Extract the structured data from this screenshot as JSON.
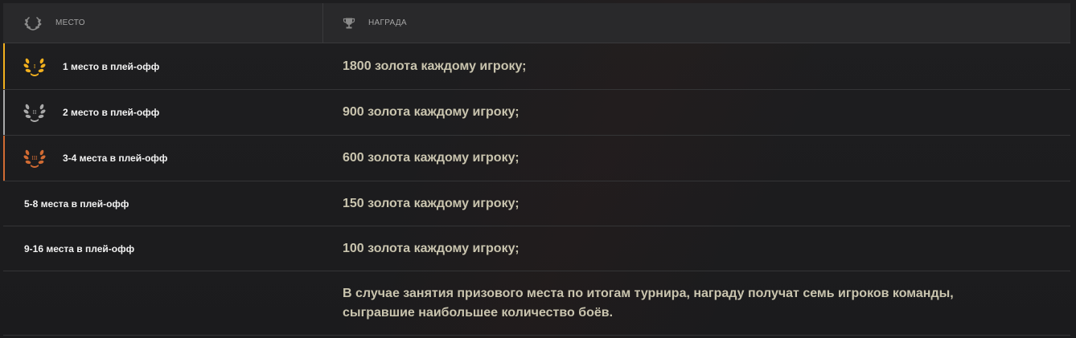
{
  "header": {
    "place_label": "МЕСТО",
    "reward_label": "НАГРАДА",
    "place_icon": "laurel-icon",
    "reward_icon": "trophy-icon"
  },
  "rows": [
    {
      "place": "1 место в плей-офф",
      "reward": "1800 золота каждому игроку;",
      "medal": "gold-laurel-icon",
      "numeral": "I",
      "color": "#f2b01e"
    },
    {
      "place": "2 место в плей-офф",
      "reward": "900 золота каждому игроку;",
      "medal": "silver-laurel-icon",
      "numeral": "II",
      "color": "#a9a9a9"
    },
    {
      "place": "3-4 места в плей-офф",
      "reward": "600 золота каждому игроку;",
      "medal": "bronze-laurel-icon",
      "numeral": "III",
      "color": "#d16b33"
    },
    {
      "place": "5-8 места в плей-офф",
      "reward": "150 золота каждому игроку;"
    },
    {
      "place": "9-16 места в плей-офф",
      "reward": "100 золота каждому игроку;"
    }
  ],
  "note": "В случае занятия призового места по итогам турнира, награду получат семь игроков команды, сыгравшие наибольшее количество боёв."
}
